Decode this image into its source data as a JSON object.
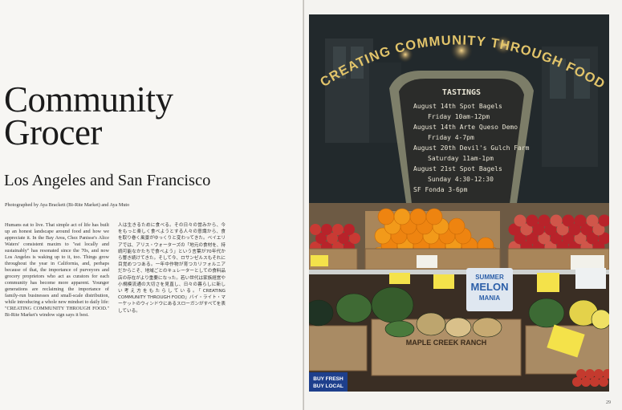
{
  "left_page": {
    "title_line1": "Community",
    "title_line2": "Grocer",
    "subtitle": "Los Angeles and San Francisco",
    "credit": "Photographed by Aya Brackett (Bi-Rite Market) and Aya Muto",
    "body_en": "Humans eat to live. That simple act of life has built up an honest landscape around food and how we appreciate it. In the Bay Area, Chez Panisse's Alice Waters' consistent maxim to \"eat locally and sustainably\" has resonated since the 70s, and now Los Angeles is waking up to it, too. Things grow throughout the year in California, and, perhaps because of that, the importance of purveyors and grocery proprietors who act as curators for each community has become more apparent. Younger generations are reclaiming the importance of family-run businesses and small-scale distribution, while introducing a whole new mindset to daily life: \"CREATING COMMUNITY THROUGH FOOD.\" Bi-Rite Market's window sign says it best.",
    "body_jp": "人は生きるために食べる。その日々の営みから、今をもっと楽しく食べようとする人々の意識から、食を取り巻く風景がゆっくりと変わってきた。ベイエリアでは、アリス・ウォーターズの「地元の食材を、持続可能なかたちで食べよう」という言葉が70年代から響き続けてきた。そして今、ロサンゼルスもそれに目覚めつつある。一年中作物が育つカリフォルニアだからこそ、地域ごとのキュレーターとしての食料品店の存在がより重要になった。若い世代は家族経営や小規模流通の大切さを見直し、日々の暮らしに新しい考え方をもたらしている。「CREATING COMMUNITY THROUGH FOOD」バイ・ライト・マーケットのウィンドウにあるスローガンがすべてを表している。"
  },
  "right_page": {
    "photo_alt": "Bi-Rite Market window display",
    "window_sign": "CREATING COMMUNITY THROUGH FOOD",
    "board_header": "TASTINGS",
    "board_lines": [
      "August 14th Spot Bagels",
      "Friday 10am-12pm",
      "August 14th Arte Queso Demo",
      "Friday 4-7pm",
      "August 20th Devil's Gulch Farm",
      "Saturday 11am-1pm",
      "August 21st Spot Bagels",
      "Sunday 4:30-12:30",
      "SF Fonda 3-6pm"
    ],
    "crate_label": "MAPLE CREEK RANCH",
    "melon_sign": "SUMMER MELON MANIA",
    "buy_sign_1": "BUY FRESH",
    "buy_sign_2": "BUY LOCAL",
    "page_number": "29"
  },
  "colors": {
    "paper": "#f7f6f3",
    "ink": "#1b1b1b",
    "sign_gold": "#e2c46a",
    "board": "#2b2c2a",
    "orange": "#f08a12",
    "apple": "#b8232a",
    "crate": "#a9865a"
  }
}
